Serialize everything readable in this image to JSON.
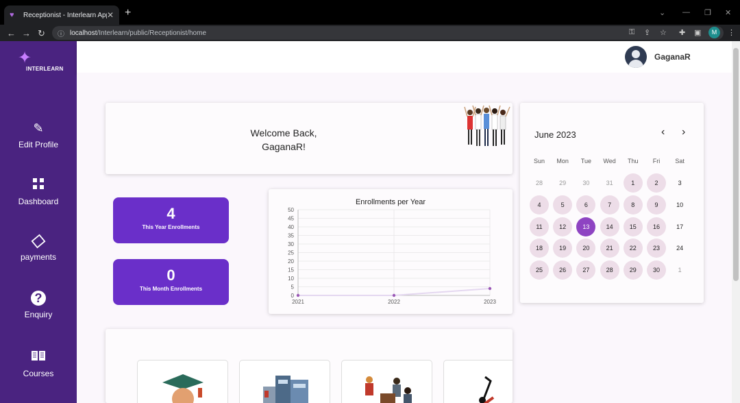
{
  "browser": {
    "tab_title": "Receptionist - Interlearn App",
    "url_host": "localhost",
    "url_path": "/Interlearn/public/Receptionist/home",
    "profile_initial": "M"
  },
  "sidebar": {
    "logo_text": "INTERLEARN",
    "items": [
      {
        "label": "Edit Profile",
        "icon": "edit-icon"
      },
      {
        "label": "Dashboard",
        "icon": "grid-icon"
      },
      {
        "label": "payments",
        "icon": "ticket-icon"
      },
      {
        "label": "Enquiry",
        "icon": "question-icon",
        "glyph": "?"
      },
      {
        "label": "Courses",
        "icon": "book-icon"
      }
    ]
  },
  "header": {
    "username": "GaganaR"
  },
  "welcome": {
    "line1": "Welcome Back,",
    "line2": "GaganaR!"
  },
  "stats": [
    {
      "value": "4",
      "label": "This Year Enrollments"
    },
    {
      "value": "0",
      "label": "This Month Enrollments"
    }
  ],
  "chart_data": {
    "type": "line",
    "title": "Enrollments per Year",
    "x": [
      "2021",
      "2022",
      "2023"
    ],
    "series": [
      {
        "values": [
          0,
          0,
          4
        ]
      }
    ],
    "ylim": [
      0,
      50
    ],
    "yticks": [
      0,
      5,
      10,
      15,
      20,
      25,
      30,
      35,
      40,
      45,
      50
    ],
    "grid": true,
    "color": "#9b59b6"
  },
  "calendar": {
    "month_label": "June 2023",
    "prev_glyph": "‹",
    "next_glyph": "›",
    "weekdays": [
      "Sun",
      "Mon",
      "Tue",
      "Wed",
      "Thu",
      "Fri",
      "Sat"
    ],
    "weeks": [
      [
        "28",
        "29",
        "30",
        "31",
        "1",
        "2",
        "3"
      ],
      [
        "4",
        "5",
        "6",
        "7",
        "8",
        "9",
        "10"
      ],
      [
        "11",
        "12",
        "13",
        "14",
        "15",
        "16",
        "17"
      ],
      [
        "18",
        "19",
        "20",
        "21",
        "22",
        "23",
        "24"
      ],
      [
        "25",
        "26",
        "27",
        "28",
        "29",
        "30",
        "1"
      ]
    ],
    "selected_day": "13",
    "accent_color": "#8e44c2"
  },
  "courses": [
    "graduation-icon",
    "building-icon",
    "classroom-icon",
    "music-icon"
  ]
}
